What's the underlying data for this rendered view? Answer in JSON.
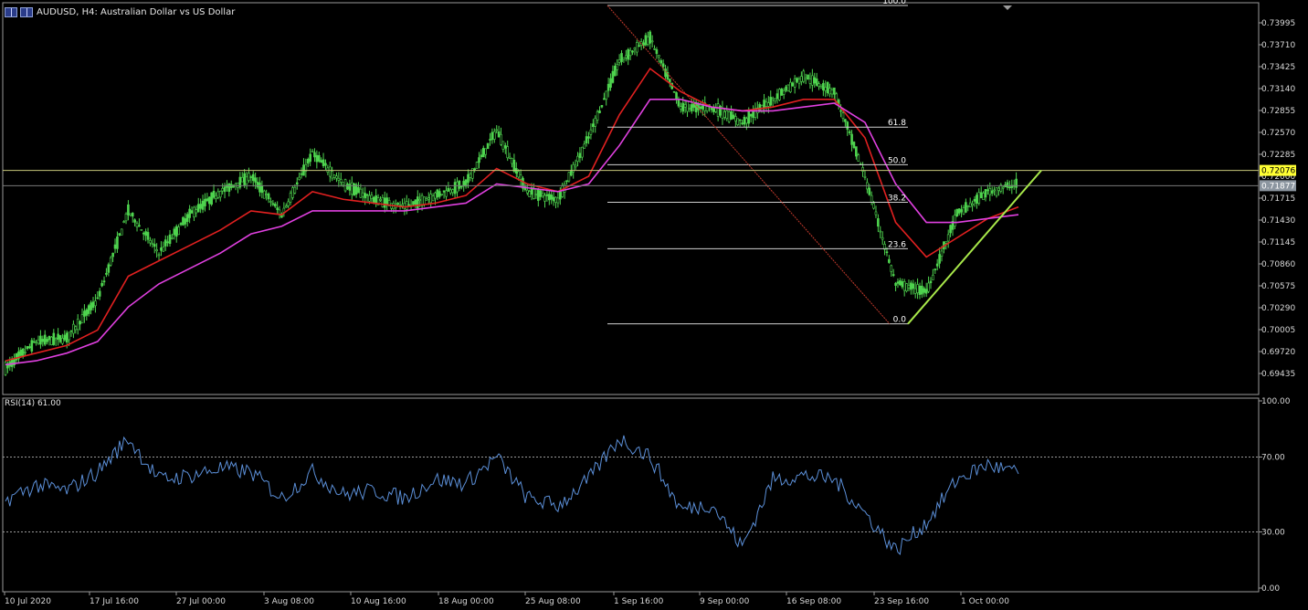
{
  "header": {
    "symbol_line": "AUDUSD, H4:  Australian Dollar vs US Dollar",
    "rsi_line": "RSI(14) 61.00"
  },
  "colors": {
    "background": "#000000",
    "candles": "#4fd54f",
    "ema_fast": "#e02020",
    "ema_slow": "#e040e0",
    "rsi": "#5b8fd8",
    "fib_line": "#d0d0d0",
    "fib_diagonal": "#c0392b",
    "trendline": "#a8e84a",
    "hline_yellow": "#c8c87a",
    "price_tag_yellow": "#ffff33",
    "price_tag_gray": "#8c96a0"
  },
  "chart_data": [
    {
      "type": "line",
      "title": "AUDUSD, H4:  Australian Dollar vs US Dollar",
      "series_kind": "candlestick price with two moving averages",
      "y_ticks": [
        "0.73995",
        "0.73710",
        "0.73425",
        "0.73140",
        "0.72855",
        "0.72570",
        "0.72285",
        "0.72000",
        "0.71715",
        "0.71430",
        "0.71145",
        "0.70860",
        "0.70575",
        "0.70290",
        "0.70005",
        "0.69720",
        "0.69435"
      ],
      "x_ticks": [
        "10 Jul 2020",
        "17 Jul 16:00",
        "27 Jul 00:00",
        "3 Aug 08:00",
        "10 Aug 16:00",
        "18 Aug 00:00",
        "25 Aug 08:00",
        "1 Sep 16:00",
        "9 Sep 00:00",
        "16 Sep 08:00",
        "23 Sep 16:00",
        "1 Oct 00:00"
      ],
      "ylim": [
        0.6925,
        0.743
      ],
      "x": [
        "10 Jul",
        "13 Jul",
        "15 Jul",
        "17 Jul",
        "20 Jul",
        "22 Jul",
        "24 Jul",
        "27 Jul",
        "29 Jul",
        "31 Jul",
        "3 Aug",
        "5 Aug",
        "7 Aug",
        "10 Aug",
        "12 Aug",
        "14 Aug",
        "18 Aug",
        "20 Aug",
        "24 Aug",
        "26 Aug",
        "28 Aug",
        "1 Sep",
        "3 Sep",
        "7 Sep",
        "9 Sep",
        "11 Sep",
        "15 Sep",
        "17 Sep",
        "21 Sep",
        "23 Sep",
        "25 Sep",
        "29 Sep",
        "1 Oct",
        "5 Oct"
      ],
      "series": [
        {
          "name": "close",
          "values": [
            0.695,
            0.6985,
            0.699,
            0.704,
            0.7155,
            0.71,
            0.715,
            0.718,
            0.72,
            0.715,
            0.723,
            0.719,
            0.717,
            0.716,
            0.7175,
            0.719,
            0.726,
            0.718,
            0.717,
            0.725,
            0.735,
            0.738,
            0.729,
            0.729,
            0.727,
            0.73,
            0.733,
            0.731,
            0.72,
            0.706,
            0.705,
            0.715,
            0.718,
            0.719
          ]
        },
        {
          "name": "ema_fast",
          "values": [
            0.696,
            0.697,
            0.698,
            0.7,
            0.707,
            0.709,
            0.711,
            0.713,
            0.7155,
            0.715,
            0.718,
            0.717,
            0.7165,
            0.716,
            0.7165,
            0.7175,
            0.721,
            0.719,
            0.718,
            0.72,
            0.728,
            0.734,
            0.731,
            0.729,
            0.7285,
            0.729,
            0.73,
            0.73,
            0.725,
            0.714,
            0.7095,
            0.712,
            0.7145,
            0.716
          ]
        },
        {
          "name": "ema_slow",
          "values": [
            0.6955,
            0.696,
            0.697,
            0.6985,
            0.703,
            0.706,
            0.708,
            0.71,
            0.7125,
            0.7135,
            0.7155,
            0.7155,
            0.7155,
            0.7155,
            0.716,
            0.7165,
            0.719,
            0.7185,
            0.718,
            0.719,
            0.724,
            0.73,
            0.73,
            0.729,
            0.7285,
            0.7285,
            0.729,
            0.7295,
            0.727,
            0.719,
            0.714,
            0.714,
            0.7145,
            0.715
          ]
        }
      ],
      "current_price": "0.71877",
      "hline_price": "0.72076",
      "fibonacci": {
        "levels": [
          "100.0",
          "61.8",
          "50.0",
          "38.2",
          "23.6",
          "0.0"
        ],
        "high": 0.7422,
        "low": 0.7008
      },
      "grid": false
    },
    {
      "type": "line",
      "title": "RSI(14) 61.00",
      "y_ticks": [
        "100.00",
        "70.00",
        "30.00",
        "0.00"
      ],
      "ylim": [
        0,
        100
      ],
      "levels": [
        70,
        30
      ],
      "series": [
        {
          "name": "RSI(14)",
          "values": [
            47,
            55,
            52,
            62,
            80,
            58,
            60,
            64,
            62,
            48,
            62,
            50,
            52,
            48,
            58,
            56,
            70,
            48,
            44,
            58,
            80,
            70,
            42,
            45,
            22,
            58,
            60,
            58,
            40,
            20,
            35,
            58,
            66,
            61
          ]
        }
      ],
      "grid": false
    }
  ]
}
